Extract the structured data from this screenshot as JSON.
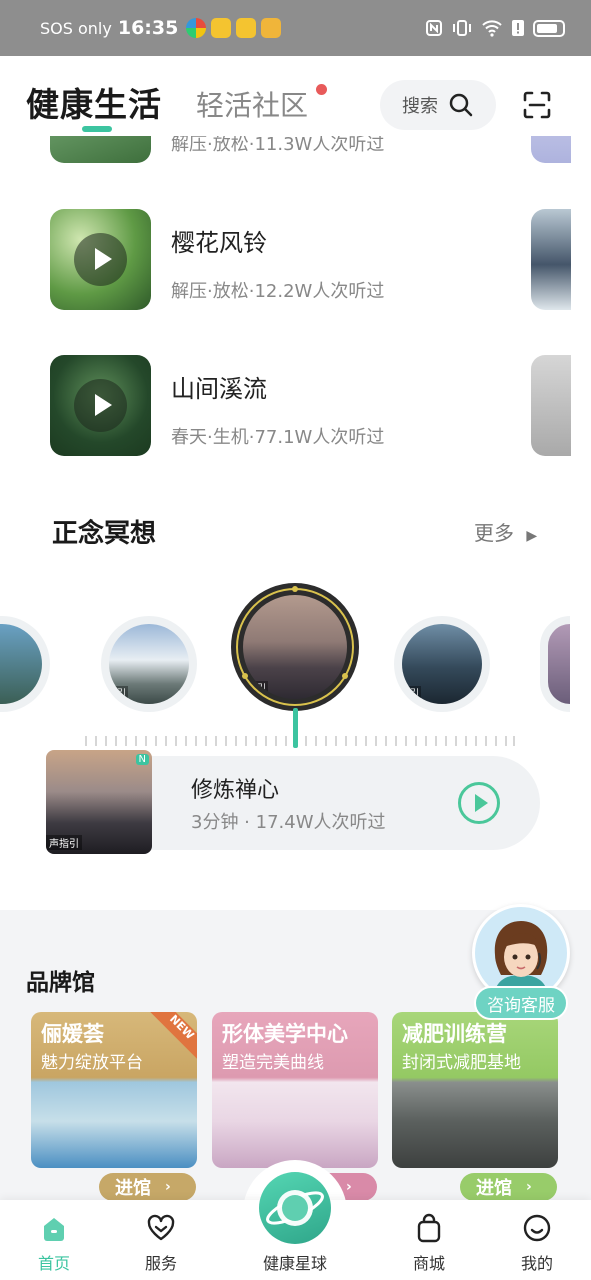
{
  "status_bar": {
    "carrier": "SOS only",
    "time": "16:35"
  },
  "header": {
    "tab_active": "健康生活",
    "tab_second": "轻活社区",
    "search_label": "搜索"
  },
  "sound_list": [
    {
      "title": "",
      "subtitle": "解压·放松·11.3W人次听过"
    },
    {
      "title": "樱花风铃",
      "subtitle": "解压·放松·12.2W人次听过"
    },
    {
      "title": "山间溪流",
      "subtitle": "春天·生机·77.1W人次听过"
    }
  ],
  "meditation": {
    "title": "正念冥想",
    "more": "更多",
    "disc_tag": "引",
    "current": {
      "title": "修炼禅心",
      "subtitle": "3分钟 · 17.4W人次听过",
      "thumb_tag": "声指引",
      "badge": "N"
    }
  },
  "brand": {
    "title": "品牌馆",
    "cards": [
      {
        "name": "俪媛荟",
        "desc": "魅力绽放平台",
        "button": "进馆",
        "ribbon": "NEW"
      },
      {
        "name": "形体美学中心",
        "desc": "塑造完美曲线",
        "button": "进馆"
      },
      {
        "name": "减肥训练营",
        "desc": "封闭式减肥基地",
        "button": "进馆"
      }
    ]
  },
  "customer_service": {
    "label": "咨询客服"
  },
  "bottom_nav": {
    "home": "首页",
    "service": "服务",
    "center": "健康星球",
    "mall": "商城",
    "mine": "我的"
  },
  "colors": {
    "accent": "#3cc4a0",
    "red_dot": "#e85a5a"
  }
}
